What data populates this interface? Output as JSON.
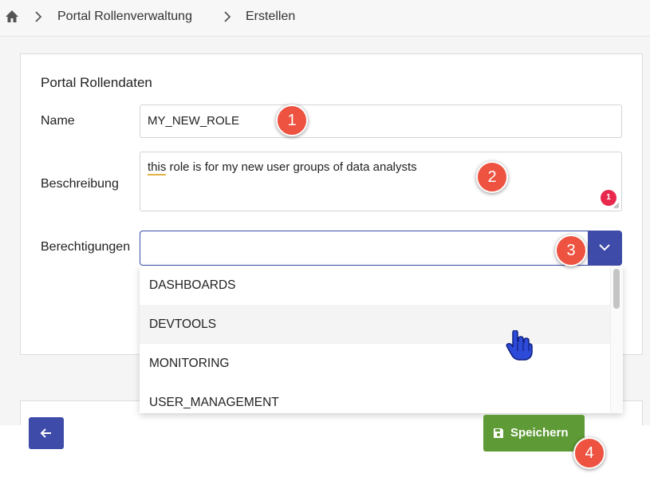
{
  "breadcrumb": {
    "items": [
      "Portal Rollenverwaltung",
      "Erstellen"
    ]
  },
  "form": {
    "section_title": "Portal Rollendaten",
    "name_label": "Name",
    "name_value": "MY_NEW_ROLE",
    "description_label": "Beschreibung",
    "description_first_word": "this",
    "description_rest": " role is for my new user groups of data analysts",
    "description_issue_count": "1",
    "permissions_label": "Berechtigungen",
    "permissions_value": ""
  },
  "dropdown": {
    "options": [
      "DASHBOARDS",
      "DEVTOOLS",
      "MONITORING",
      "USER_MANAGEMENT"
    ],
    "hovered_index": 1
  },
  "footer": {
    "save_label": "Speichern"
  },
  "markers": [
    "1",
    "2",
    "3",
    "4"
  ],
  "colors": {
    "primary": "#3e4ba8",
    "save": "#5e9a35",
    "marker": "#ee5240",
    "badge": "#e8294d"
  }
}
